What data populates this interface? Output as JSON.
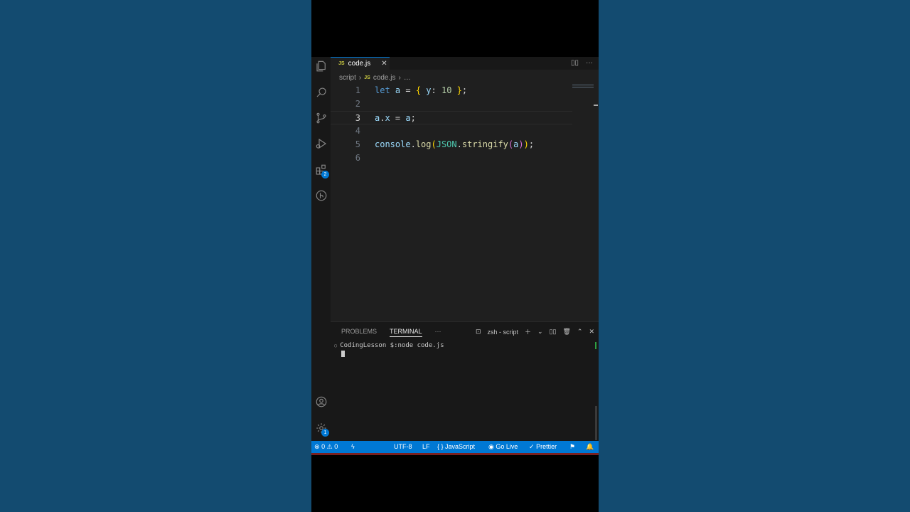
{
  "tab": {
    "lang": "JS",
    "name": "code.js",
    "close": "✕"
  },
  "breadcrumb": {
    "folder": "script",
    "sep": "›",
    "lang": "JS",
    "file": "code.js",
    "rest": "…"
  },
  "editor": {
    "line_numbers": [
      "1",
      "2",
      "3",
      "4",
      "5",
      "6"
    ],
    "line1": {
      "kw": "let",
      "a": "a",
      "eq": " = ",
      "ob": "{",
      "y": " y",
      "colon": ": ",
      "num": "10",
      "cb": " }",
      "semi": ";"
    },
    "line3": {
      "text_a": "a",
      "dot": ".",
      "x": "x",
      "eq": " = ",
      "a2": "a",
      "semi": ";"
    },
    "line5": {
      "console": "console",
      "dot": ".",
      "log": "log",
      "p1": "(",
      "json": "JSON",
      "dot2": ".",
      "stringify": "stringify",
      "p2": "(",
      "arg": "a",
      "p3": ")",
      "p4": ")",
      "semi": ";"
    }
  },
  "panel": {
    "tabs": [
      "PROBLEMS",
      "TERMINAL",
      "···"
    ],
    "terminal_name": "zsh - script",
    "prompt": "CodingLesson $:node code.js"
  },
  "status": {
    "errors": "0",
    "warnings": "0",
    "encoding": "UTF-8",
    "eol": "LF",
    "language": "JavaScript",
    "golive": "Go Live",
    "prettier": "Prettier"
  },
  "badges": {
    "extensions": "2",
    "settings": "1"
  },
  "colors": {
    "accent": "#0078d4",
    "editor_bg": "#1f1f1f",
    "page_bg": "#134b70"
  }
}
